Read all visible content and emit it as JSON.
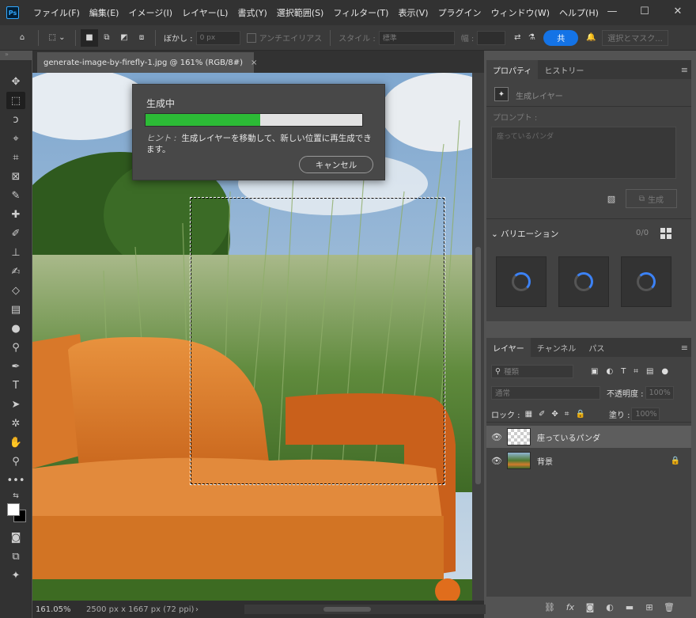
{
  "app": {
    "logo": "Ps"
  },
  "menu": [
    "ファイル(F)",
    "編集(E)",
    "イメージ(I)",
    "レイヤー(L)",
    "書式(Y)",
    "選択範囲(S)",
    "フィルター(T)",
    "表示(V)",
    "プラグイン",
    "ウィンドウ(W)",
    "ヘルプ(H)"
  ],
  "window_controls": {
    "minimize": "—",
    "maximize": "☐",
    "close": "✕"
  },
  "options": {
    "feather_label": "ぼかし :",
    "feather_value": "0 px",
    "antialias_label": "アンチエイリアス",
    "style_label": "スタイル :",
    "style_value": "標準",
    "width_label": "幅 :",
    "share_label": "共",
    "select_mask_label": "選択とマスク..."
  },
  "document": {
    "tab_title": "generate-image-by-firefly-1.jpg @ 161% (RGB/8#)",
    "tab_close": "×",
    "zoom": "161.05%",
    "dimensions": "2500 px x 1667 px (72 ppi)"
  },
  "progress_dialog": {
    "title": "生成中",
    "progress": 0.53,
    "hint_label": "ヒント :",
    "hint_text": "生成レイヤーを移動して、新しい位置に再生成できます。",
    "cancel_label": "キャンセル"
  },
  "properties": {
    "tabs": [
      "プロパティ",
      "ヒストリー"
    ],
    "layer_type": "生成レイヤー",
    "prompt_label": "プロンプト :",
    "prompt_value": "座っているパンダ",
    "generate_label": "生成",
    "variations_label": "バリエーション",
    "variations_count": "0/0"
  },
  "layers": {
    "tabs": [
      "レイヤー",
      "チャンネル",
      "パス"
    ],
    "search_placeholder": "種類",
    "blend_mode": "通常",
    "opacity_label": "不透明度 :",
    "opacity_value": "100%",
    "lock_label": "ロック :",
    "fill_label": "塗り :",
    "fill_value": "100%",
    "items": [
      {
        "name": "座っているパンダ",
        "selected": true,
        "thumb": "generative"
      },
      {
        "name": "背景",
        "selected": false,
        "thumb": "photo",
        "locked": true
      }
    ]
  },
  "colors": {
    "accent": "#1473e6",
    "progress": "#2cbb36",
    "panel": "#424242"
  }
}
